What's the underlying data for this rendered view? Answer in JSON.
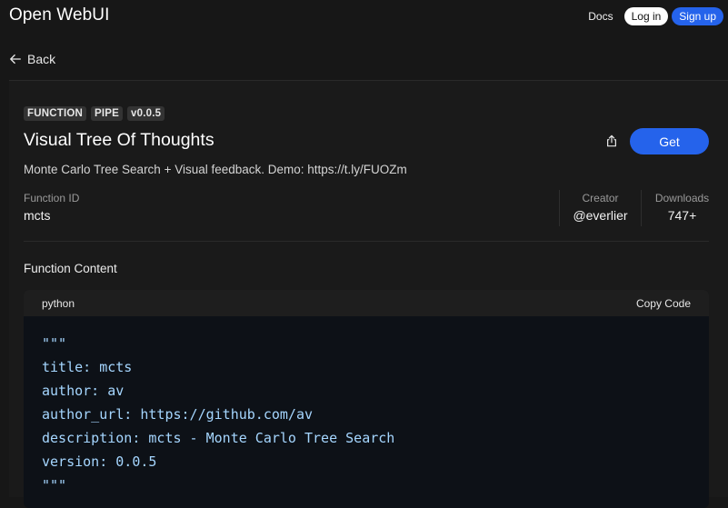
{
  "header": {
    "brand": "Open WebUI",
    "docs_label": "Docs",
    "login_label": "Log in",
    "signup_label": "Sign up"
  },
  "back_label": "Back",
  "function": {
    "tags": [
      "FUNCTION",
      "PIPE",
      "v0.0.5"
    ],
    "title": "Visual Tree Of Thoughts",
    "description": "Monte Carlo Tree Search + Visual feedback. Demo: https://t.ly/FUOZm",
    "get_label": "Get",
    "share_icon": "share-icon",
    "id_label": "Function ID",
    "id_value": "mcts",
    "creator_label": "Creator",
    "creator_value": "@everlier",
    "downloads_label": "Downloads",
    "downloads_value": "747+"
  },
  "content_section": {
    "title": "Function Content",
    "language": "python",
    "copy_label": "Copy Code",
    "code_lines": [
      "\"\"\"",
      "title: mcts",
      "author: av",
      "author_url: https://github.com/av",
      "description: mcts - Monte Carlo Tree Search",
      "version: 0.0.5",
      "\"\"\""
    ]
  },
  "colors": {
    "background": "#171717",
    "accent": "#2563eb",
    "code_text": "#a5d6ff",
    "code_background": "#0d1117"
  }
}
